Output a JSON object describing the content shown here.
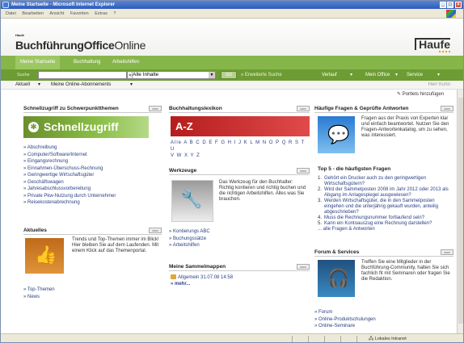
{
  "window": {
    "title": "Meine Startseite - Microsoft Internet Explorer"
  },
  "menu": [
    "Datei",
    "Bearbeiten",
    "Ansicht",
    "Favoriten",
    "Extras",
    "?"
  ],
  "header": {
    "logo_small": "Haufe",
    "logo_main": "BuchführungOffice",
    "logo_suffix": "Online",
    "brand": "Haufe"
  },
  "nav": {
    "tabs": [
      "Meine Startseite",
      "Buchhaltung",
      "Arbeitshilfen"
    ]
  },
  "search": {
    "label": "Suche",
    "value": "",
    "scope": "Alle Inhalte",
    "go_label": "GO",
    "extended": "» Erweiterte Suche",
    "right_links": [
      "Verlauf",
      "Mein Office",
      "Service"
    ]
  },
  "subbar": {
    "aktuell": "Aktuell",
    "abo": "Meine Online-Abonnements",
    "user": "Herr Kuhn"
  },
  "portlets_add": "Portlets hinzufügen",
  "schnellzugriff": {
    "title": "Schnellzugriff zu Schwerpunktthemen",
    "banner": "Schnellzugriff",
    "links": [
      "Abschreibung",
      "Computer/Software/Internet",
      "Eingangsrechnung",
      "Einnahmen-Überschuss-Rechnung",
      "Geringwertige Wirtschaftsgüter",
      "Geschäftswagen",
      "Jahresabschlussvorbereitung",
      "Private Pkw-Nutzung durch Unternehmer",
      "Reisekostenabrechnung"
    ]
  },
  "aktuelles": {
    "title": "Aktuelles",
    "text": "Trends und Top-Themen immer im Blick! Hier bleiben Sie auf dem Laufenden. Mit einem Klick auf das Themenportal.",
    "links": [
      "Top-Themen",
      "News"
    ]
  },
  "lexikon": {
    "title": "Buchhaltungslexikon",
    "banner": "A-Z",
    "alphabet_line1": "Alle A B C D E F G H I J K L M N O P Q R S T U",
    "alphabet_line2": "V W X Y Z"
  },
  "werkzeuge": {
    "title": "Werkzeuge",
    "text": "Das Werkzeug für den Buchhalter: Richtig kontieren und richtig buchen und die richtigen Arbeitshilfen. Alles was Sie brauchen.",
    "links": [
      "Kontierungs ABC",
      "Buchungssätze",
      "Arbeitshilfen"
    ]
  },
  "sammelmappen": {
    "title": "Meine Sammelmappen",
    "item": "Allgemein 31.07.08 14:58",
    "more": "» mehr..."
  },
  "faq": {
    "title": "Häufige Fragen & Geprüfte Antworten",
    "text": "Fragen aus der Praxis von Experten klar und einfach beantwortet. Nutzen Sie den Fragen-Antwortenkatalog, um zu sehen, was interessiert.",
    "top5_title": "Top 5 - die häufigsten Fragen",
    "top5": [
      "Gehört ein Drucker auch zu den geringwertigen Wirtschaftsgütern?",
      "Wird der Sammelposten 2008 im Jahr 2012 oder 2013 als Abgang im Anlagespiegel ausgewiesen?",
      "Werden Wirtschaftsgüter, die in den Sammelposten eingehen und die unterjährig gekauft wurden, anteilig abgeschrieben?",
      "Muss die Rechnungsnummer fortlaufend sein?",
      "Kann ein Kontoauszug eine Rechnung darstellen?"
    ],
    "all_link": "... alle Fragen & Antworten"
  },
  "forum": {
    "title": "Forum & Services",
    "text": "Treffen Sie eine Mitglieder in der Buchführung-Community, halten Sie sich fachlich fit mit Seminaren oder fragen Sie die Redaktion.",
    "links": [
      "Forum",
      "Online-Produktschulungen",
      "Online-Seminare"
    ]
  },
  "status": {
    "zone": "Lokales Intranet"
  }
}
